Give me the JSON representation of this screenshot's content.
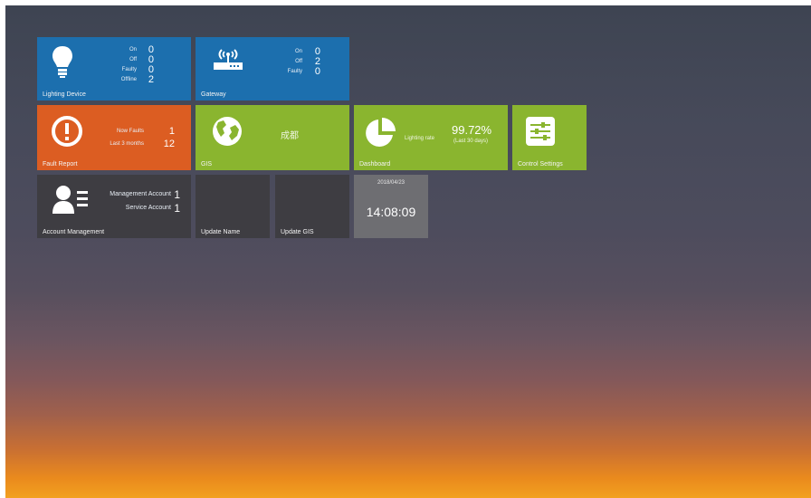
{
  "tiles": {
    "lighting": {
      "title": "Lighting Device",
      "stats": [
        {
          "label": "On",
          "value": "0"
        },
        {
          "label": "Off",
          "value": "0"
        },
        {
          "label": "Faulty",
          "value": "0"
        },
        {
          "label": "Offline",
          "value": "2"
        }
      ]
    },
    "gateway": {
      "title": "Gateway",
      "stats": [
        {
          "label": "On",
          "value": "0"
        },
        {
          "label": "Off",
          "value": "2"
        },
        {
          "label": "Faulty",
          "value": "0"
        }
      ]
    },
    "fault": {
      "title": "Fault Report",
      "stats": [
        {
          "label": "Now Faults",
          "value": "1"
        },
        {
          "label": "Last 3 months",
          "value": "12"
        }
      ]
    },
    "gis": {
      "title": "GIS",
      "city": "成都"
    },
    "dashboard": {
      "title": "Dashboard",
      "rate_label": "Lighting rate",
      "rate_value": "99.72%",
      "rate_period": "(Last 30 days)"
    },
    "control": {
      "title": "Control Settings"
    },
    "account": {
      "title": "Account Management",
      "stats": [
        {
          "label": "Management Account",
          "value": "1"
        },
        {
          "label": "Service Account",
          "value": "1"
        }
      ]
    },
    "update_name": {
      "title": "Update Name"
    },
    "update_gis": {
      "title": "Update GIS"
    },
    "clock": {
      "date": "2018/04/23",
      "time": "14:08:09"
    }
  },
  "colors": {
    "blue": "#1c6fae",
    "orange": "#dc5d22",
    "green": "#8ab52f",
    "dark": "#3e3d42",
    "gray": "#6e6e72"
  },
  "icons": [
    "lightbulb-icon",
    "wifi-router-icon",
    "alert-icon",
    "globe-icon",
    "pie-chart-icon",
    "sliders-icon",
    "users-icon"
  ]
}
